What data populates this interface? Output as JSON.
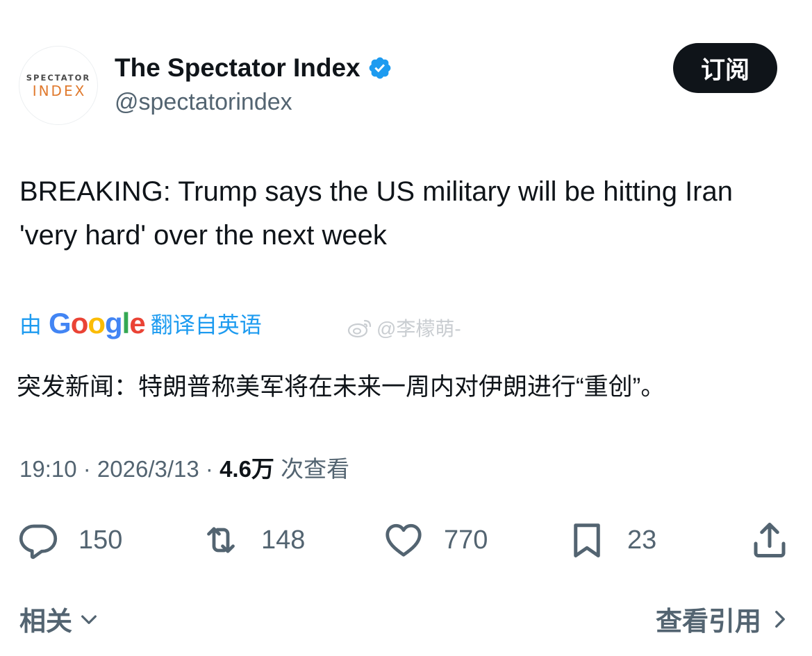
{
  "author": {
    "avatar_logo_top": "SPECTATOR",
    "avatar_logo_bottom": "INDEX",
    "display_name": "The Spectator Index",
    "handle": "@spectatorindex",
    "verified_icon": "verified-badge-icon",
    "verified_color": "#1d9bf0"
  },
  "subscribe_label": "订阅",
  "tweet": {
    "text": "BREAKING: Trump says the US military will be hitting Iran 'very hard' over the next week"
  },
  "translation": {
    "prefix": "由",
    "provider": "Google",
    "suffix": "翻译自英语",
    "text": "突发新闻：特朗普称美军将在未来一周内对伊朗进行“重创”。",
    "link_color": "#1d9bf0"
  },
  "watermark": {
    "text": "@李檬萌-",
    "icon": "weibo-icon"
  },
  "meta": {
    "time": "19:10",
    "separator": " · ",
    "date": "2026/3/13",
    "views": "4.6万",
    "views_label": " 次查看"
  },
  "actions": {
    "reply": {
      "icon": "reply-icon",
      "count": "150"
    },
    "retweet": {
      "icon": "retweet-icon",
      "count": "148"
    },
    "like": {
      "icon": "heart-icon",
      "count": "770"
    },
    "bookmark": {
      "icon": "bookmark-icon",
      "count": "23"
    },
    "share": {
      "icon": "share-icon"
    }
  },
  "footer": {
    "related_label": "相关",
    "related_icon": "chevron-down-icon",
    "quotes_label": "查看引用",
    "quotes_icon": "chevron-right-icon"
  },
  "colors": {
    "text_primary": "#0f1419",
    "text_secondary": "#536471",
    "button_bg": "#0f1419",
    "logo_accent": "#e07a2e"
  }
}
